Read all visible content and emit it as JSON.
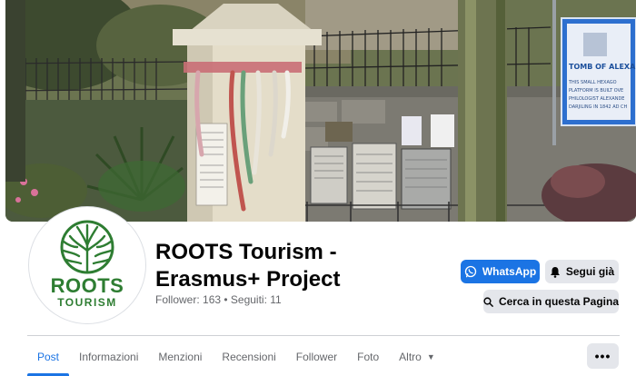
{
  "cover": {
    "plaque_title": "TOMB OF ALEXA",
    "plaque_lines": [
      "THIS SMALL HEXAGO",
      "PLATFORM IS BUILT OVE",
      "PHILOLOGIST ALEXANDE",
      "DARJILING IN 1842 AD CH"
    ]
  },
  "logo": {
    "title": "ROOTS",
    "subtitle": "TOURISM"
  },
  "profile": {
    "name": "ROOTS Tourism - Erasmus+ Project",
    "stats": "Follower: 163 • Seguiti: 11"
  },
  "actions": {
    "whatsapp_label": "WhatsApp",
    "follow_label": "Segui già",
    "search_label": "Cerca in questa Pagina"
  },
  "tabs": [
    {
      "label": "Post",
      "active": true
    },
    {
      "label": "Informazioni"
    },
    {
      "label": "Menzioni"
    },
    {
      "label": "Recensioni"
    },
    {
      "label": "Follower"
    },
    {
      "label": "Foto"
    },
    {
      "label": "Altro"
    }
  ],
  "more_button": {
    "label": "•••"
  },
  "colors": {
    "accent": "#1b74e4",
    "logo_green": "#2e7d32",
    "secondary_bg": "#e4e6eb",
    "muted_text": "#65676b"
  },
  "icons": [
    "whatsapp-icon",
    "bell-icon",
    "search-icon",
    "caret-down-icon",
    "more-dots-icon",
    "tree-roots-logo"
  ]
}
